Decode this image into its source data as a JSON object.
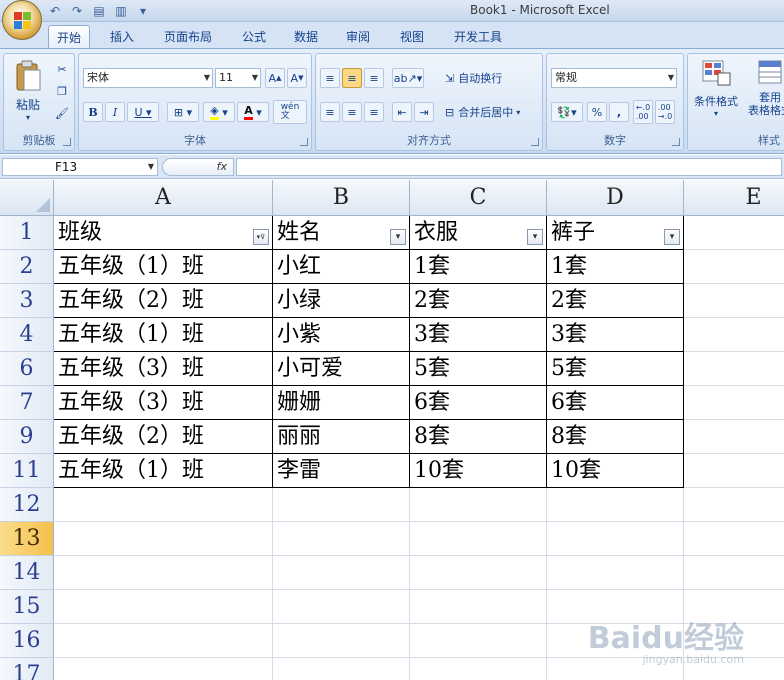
{
  "window": {
    "title": "Book1 - Microsoft Excel"
  },
  "tabs": [
    "开始",
    "插入",
    "页面布局",
    "公式",
    "数据",
    "审阅",
    "视图",
    "开发工具"
  ],
  "ribbon": {
    "clipboard": {
      "label": "剪贴板",
      "paste": "粘贴"
    },
    "font": {
      "label": "字体",
      "name": "宋体",
      "size": "11",
      "bold": "B",
      "italic": "I",
      "underline": "U",
      "font_color": "A",
      "phonetic": "wén\n文"
    },
    "alignment": {
      "label": "对齐方式",
      "wrap": "自动换行",
      "merge": "合并后居中"
    },
    "number": {
      "label": "数字",
      "format": "常规",
      "percent": "%",
      "comma": ",",
      "inc_decimal": "←.0\n.00",
      "dec_decimal": ".00\n→.0"
    },
    "styles": {
      "label": "样式",
      "conditional": "条件格式",
      "table_format": "套用\n表格格式"
    }
  },
  "formula_bar": {
    "name_box": "F13",
    "fx": "fx",
    "content": ""
  },
  "columns": [
    "A",
    "B",
    "C",
    "D",
    "E"
  ],
  "rows": [
    {
      "num": "1",
      "cells": [
        "班级",
        "姓名",
        "衣服",
        "裤子"
      ],
      "header": true
    },
    {
      "num": "2",
      "cells": [
        "五年级（1）班",
        "小红",
        "1套",
        "1套"
      ]
    },
    {
      "num": "3",
      "cells": [
        "五年级（2）班",
        "小绿",
        "2套",
        "2套"
      ]
    },
    {
      "num": "4",
      "cells": [
        "五年级（1）班",
        "小紫",
        "3套",
        "3套"
      ]
    },
    {
      "num": "6",
      "cells": [
        "五年级（3）班",
        "小可爱",
        "5套",
        "5套"
      ]
    },
    {
      "num": "7",
      "cells": [
        "五年级（3）班",
        "姗姗",
        "6套",
        "6套"
      ]
    },
    {
      "num": "9",
      "cells": [
        "五年级（2）班",
        "丽丽",
        "8套",
        "8套"
      ]
    },
    {
      "num": "11",
      "cells": [
        "五年级（1）班",
        "李雷",
        "10套",
        "10套"
      ]
    },
    {
      "num": "12",
      "cells": [
        "",
        "",
        "",
        ""
      ]
    },
    {
      "num": "13",
      "cells": [
        "",
        "",
        "",
        ""
      ],
      "selected": true
    },
    {
      "num": "14",
      "cells": [
        "",
        "",
        "",
        ""
      ]
    },
    {
      "num": "15",
      "cells": [
        "",
        "",
        "",
        ""
      ]
    },
    {
      "num": "16",
      "cells": [
        "",
        "",
        "",
        ""
      ]
    },
    {
      "num": "17",
      "cells": [
        "",
        "",
        "",
        ""
      ]
    }
  ],
  "watermark": {
    "text": "Baidu经验",
    "sub": "jingyan.baidu.com"
  }
}
